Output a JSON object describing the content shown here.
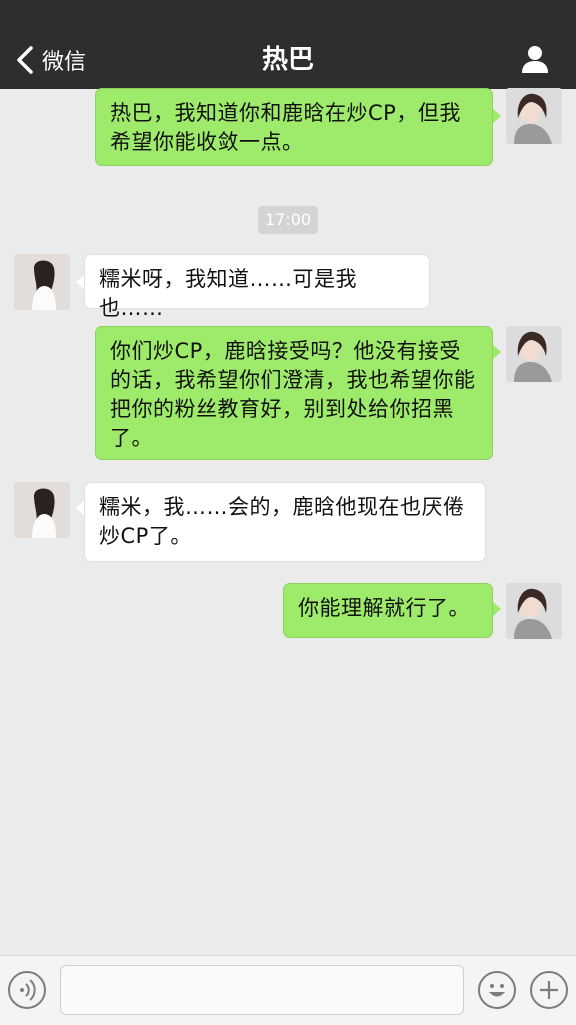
{
  "nav": {
    "back_label": "微信",
    "title": "热巴"
  },
  "messages": [
    {
      "sender": "me",
      "text": "热巴，我知道你和鹿晗在炒CP，但我希望你能收敛一点。"
    },
    {
      "sender": "other",
      "text": "糯米呀，我知道……可是我也……"
    },
    {
      "sender": "me",
      "text": "你们炒CP，鹿晗接受吗？他没有接受的话，我希望你们澄清，我也希望你能把你的粉丝教育好，别到处给你招黑了。"
    },
    {
      "sender": "other",
      "text": "糯米，我……会的，鹿晗他现在也厌倦炒CP了。"
    },
    {
      "sender": "me",
      "text": "你能理解就行了。"
    }
  ],
  "timestamp": "17:00",
  "input": {
    "placeholder": ""
  },
  "colors": {
    "navbar": "#2e2e30",
    "my_bubble": "#9eea6a",
    "their_bubble": "#ffffff",
    "background": "#ebebeb"
  },
  "icons": {
    "back": "chevron-left-icon",
    "profile": "person-icon",
    "voice": "voice-icon",
    "emoji": "emoji-icon",
    "plus": "plus-icon"
  }
}
